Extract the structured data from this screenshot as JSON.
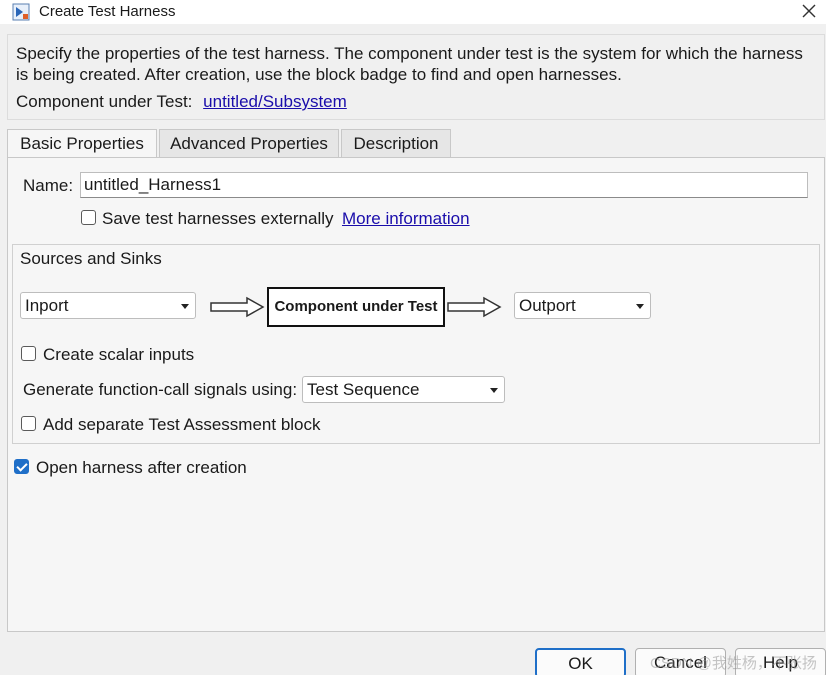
{
  "window": {
    "title": "Create Test Harness",
    "app_icon": "simulink-harness-icon",
    "close_icon": "close-icon"
  },
  "description": {
    "text": "Specify the properties of the test harness. The component under test is the system for which the harness is being created. After creation, use the block badge to find and open harnesses.",
    "cut_label": "Component under Test:",
    "cut_link": "untitled/Subsystem"
  },
  "tabs": [
    {
      "label": "Basic Properties",
      "active": true
    },
    {
      "label": "Advanced Properties",
      "active": false
    },
    {
      "label": "Description",
      "active": false
    }
  ],
  "basic": {
    "name_label": "Name:",
    "name_value": "untitled_Harness1",
    "save_externally_label": "Save test harnesses externally",
    "save_externally_checked": false,
    "more_info_link": "More information",
    "sources_sinks": {
      "title": "Sources and Sinks",
      "source_value": "Inport",
      "cut_box_label": "Component under Test",
      "sink_value": "Outport",
      "scalar_inputs_label": "Create scalar inputs",
      "scalar_inputs_checked": false,
      "function_call_label": "Generate function-call signals using:",
      "function_call_value": "Test Sequence",
      "assessment_label": "Add separate Test Assessment block",
      "assessment_checked": false
    },
    "open_after_label": "Open harness after creation",
    "open_after_checked": true
  },
  "footer": {
    "ok": "OK",
    "cancel": "Cancel",
    "help": "Help",
    "watermark": "CSDN @我姓杨，不张扬"
  },
  "colors": {
    "accent": "#1f6fc8",
    "link": "#1a0dab"
  }
}
